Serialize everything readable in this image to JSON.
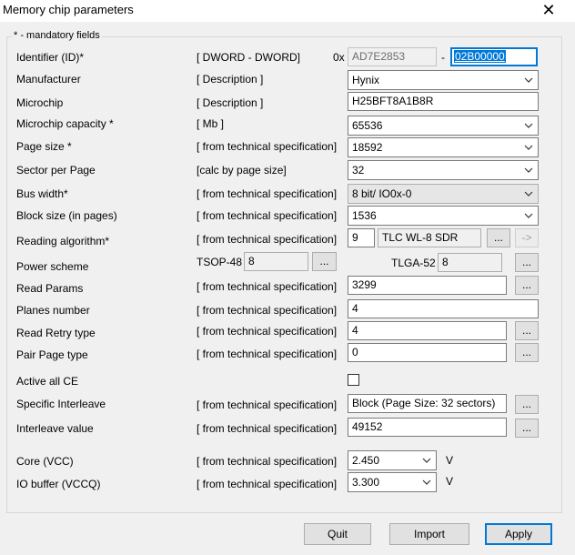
{
  "window": {
    "title": "Memory chip parameters"
  },
  "legend": "* - mandatory fields",
  "rows": {
    "identifier": {
      "label": "Identifier (ID)*",
      "hint": "[ DWORD - DWORD]",
      "prefix": "0x",
      "value1": "AD7E2853",
      "dash": "-",
      "value2": "02B00000"
    },
    "manufacturer": {
      "label": "Manufacturer",
      "hint": "[ Description ]",
      "value": "Hynix"
    },
    "microchip": {
      "label": "Microchip",
      "hint": "[ Description ]",
      "value": "H25BFT8A1B8R"
    },
    "capacity": {
      "label": "Microchip capacity *",
      "hint": "[ Mb ]",
      "value": "65536"
    },
    "page_size": {
      "label": "Page size *",
      "hint": "[ from technical specification]",
      "value": "18592"
    },
    "sector_per_page": {
      "label": "Sector per Page",
      "hint": "[calc by page size]",
      "value": "32"
    },
    "bus_width": {
      "label": "Bus width*",
      "hint": "[ from technical specification]",
      "value": "8 bit/ IO0x-0"
    },
    "block_size": {
      "label": "Block size (in pages)",
      "hint": "[ from technical specification]",
      "value": "1536"
    },
    "reading_algorithm": {
      "label": "Reading algorithm*",
      "hint": "[ from technical specification]",
      "value": "9",
      "name": "TLC WL-8 SDR",
      "btn1": "...",
      "btn2": "->"
    },
    "power_scheme": {
      "label": "Power scheme",
      "tsop_label": "TSOP-48",
      "tsop_value": "8",
      "tsop_btn": "...",
      "tlga_label": "TLGA-52",
      "tlga_value": "8",
      "tlga_btn": "..."
    },
    "read_params": {
      "label": "Read Params",
      "hint": "[ from technical specification]",
      "value": "3299",
      "btn": "..."
    },
    "planes": {
      "label": "Planes number",
      "hint": "[ from technical specification]",
      "value": "4"
    },
    "read_retry": {
      "label": "Read Retry type",
      "hint": "[ from technical specification]",
      "value": "4",
      "btn": "..."
    },
    "pair_page": {
      "label": "Pair Page type",
      "hint": "[ from technical specification]",
      "value": "0",
      "btn": "..."
    },
    "active_ce": {
      "label": "Active all CE",
      "checked": false
    },
    "interleave": {
      "label": "Specific Interleave",
      "hint": "[ from technical specification]",
      "value": "Block (Page Size: 32 sectors)",
      "btn": "..."
    },
    "interleave_value": {
      "label": "Interleave value",
      "hint": "[ from technical specification]",
      "value": "49152",
      "btn": "..."
    },
    "core_vcc": {
      "label": "Core (VCC)",
      "hint": "[ from technical specification]",
      "value": "2.450",
      "unit": "V"
    },
    "io_vccq": {
      "label": "IO buffer (VCCQ)",
      "hint": "[ from technical specification]",
      "value": "3.300",
      "unit": "V"
    }
  },
  "buttons": {
    "quit": "Quit",
    "import": "Import",
    "apply": "Apply"
  },
  "icons": {
    "close": "close-icon",
    "dropdown": "chevron-down-icon"
  }
}
